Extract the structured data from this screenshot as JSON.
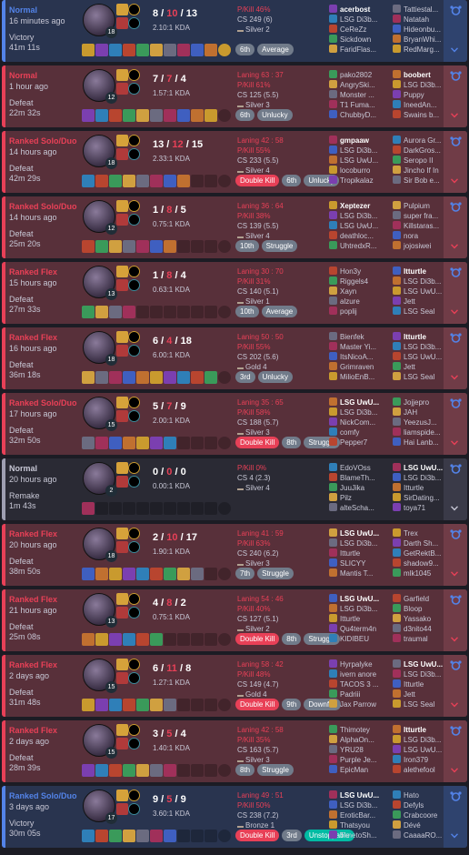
{
  "icons": {
    "expand": "chevron-down-icon",
    "tag": "share-icon"
  },
  "colors": {
    "win": "#5383e8",
    "loss": "#e84057",
    "remake": "#9e9eb1",
    "badge": "#717b8a",
    "badge_multikill": "#e84057",
    "badge_top": "#00bba3"
  },
  "matches": [
    {
      "result": "win",
      "queue": "Normal",
      "ago": "16 minutes ago",
      "outcome": "Victory",
      "duration": "41m 11s",
      "level": "18",
      "kda": {
        "k": "8",
        "d": "10",
        "a": "13"
      },
      "kda_ratio": "2.10:1 KDA",
      "laning": "",
      "pk": "P/Kill 46%",
      "cs": "CS 249 (6)",
      "rank": "Silver 2",
      "items": 11,
      "badges": [
        "6th",
        "Average"
      ],
      "team1": [
        "acerbost",
        "LSG Di3b...",
        "CeReZz",
        "Sickdown",
        "FaridFlas..."
      ],
      "team2": [
        "Tattiestal...",
        "Natatah",
        "Hideonbu...",
        "BryanWhi...",
        "RedMarg..."
      ],
      "me": 1
    },
    {
      "result": "loss",
      "queue": "Normal",
      "ago": "1 hour ago",
      "outcome": "Defeat",
      "duration": "22m 32s",
      "level": "12",
      "kda": {
        "k": "7",
        "d": "7",
        "a": "4"
      },
      "kda_ratio": "1.57:1 KDA",
      "laning": "Laning 63 : 37",
      "pk": "P/Kill 61%",
      "cs": "CS 125 (5.5)",
      "rank": "Silver 3",
      "items": 10,
      "badges": [
        "6th",
        "Unlucky"
      ],
      "team1": [
        "pako2802",
        "AngrySki...",
        "Monster ...",
        "T1 Fuma...",
        "ChubbyD..."
      ],
      "team2": [
        "boobert",
        "LSG Di3b...",
        "Puppy",
        "IneedAn...",
        "Swains b..."
      ],
      "me": 6
    },
    {
      "result": "loss",
      "queue": "Ranked Solo/Duo",
      "ago": "14 hours ago",
      "outcome": "Defeat",
      "duration": "42m 29s",
      "level": "18",
      "kda": {
        "k": "13",
        "d": "12",
        "a": "15"
      },
      "kda_ratio": "2.33:1 KDA",
      "laning": "Laning 42 : 58",
      "pk": "P/Kill 55%",
      "cs": "CS 233 (5.5)",
      "rank": "Silver 4",
      "items": 8,
      "badges": [
        "Double Kill",
        "6th",
        "Unlucky"
      ],
      "team1": [
        "gmpaaw",
        "LSG Di3b...",
        "LSG UwU...",
        "locoburro",
        "Tropikalaz"
      ],
      "team2": [
        "Aurora Gr...",
        "DarkGros...",
        "Seropo II",
        "Jincho If In",
        "Sir Bob e..."
      ],
      "me": 1
    },
    {
      "result": "loss",
      "queue": "Ranked Solo/Duo",
      "ago": "14 hours ago",
      "outcome": "Defeat",
      "duration": "25m 20s",
      "level": "12",
      "kda": {
        "k": "1",
        "d": "8",
        "a": "5"
      },
      "kda_ratio": "0.75:1 KDA",
      "laning": "Laning 36 : 64",
      "pk": "P/Kill 38%",
      "cs": "CS 139 (5.5)",
      "rank": "Silver 4",
      "items": 7,
      "badges": [
        "10th",
        "Struggle"
      ],
      "team1": [
        "Xeptezer",
        "LSG Di3b...",
        "LSG UwU...",
        "deathloc...",
        "UhtredxR..."
      ],
      "team2": [
        "Pulpium",
        "super fra...",
        "Killstaras...",
        "nora",
        "jojosiwei"
      ],
      "me": 1
    },
    {
      "result": "loss",
      "queue": "Ranked Flex",
      "ago": "15 hours ago",
      "outcome": "Defeat",
      "duration": "27m 33s",
      "level": "13",
      "kda": {
        "k": "1",
        "d": "8",
        "a": "4"
      },
      "kda_ratio": "0.63:1 KDA",
      "laning": "Laning 30 : 70",
      "pk": "P/Kill 31%",
      "cs": "CS 140 (5.1)",
      "rank": "Silver 1",
      "items": 4,
      "badges": [
        "10th",
        "Average"
      ],
      "team1": [
        "Hon3y",
        "Riggels4",
        "Xayn",
        "alzure",
        "poplij"
      ],
      "team2": [
        "Itturtle",
        "LSG Di3b...",
        "LSG UwU...",
        "Jett",
        "LSG Seal"
      ],
      "me": 6
    },
    {
      "result": "loss",
      "queue": "Ranked Flex",
      "ago": "16 hours ago",
      "outcome": "Defeat",
      "duration": "36m 18s",
      "level": "18",
      "kda": {
        "k": "6",
        "d": "4",
        "a": "18"
      },
      "kda_ratio": "6.00:1 KDA",
      "laning": "Laning 50 : 50",
      "pk": "P/Kill 55%",
      "cs": "CS 202 (5.6)",
      "rank": "Gold 4",
      "items": 10,
      "badges": [
        "3rd",
        "Unlucky"
      ],
      "team1": [
        "Bienfek",
        "Master Yi...",
        "ItsNicoA...",
        "Grimraven",
        "MilioEnB..."
      ],
      "team2": [
        "Itturtle",
        "LSG Di3b...",
        "LSG UwU...",
        "Jett",
        "LSG Seal"
      ],
      "me": 6
    },
    {
      "result": "loss",
      "queue": "Ranked Solo/Duo",
      "ago": "17 hours ago",
      "outcome": "Defeat",
      "duration": "32m 50s",
      "level": "15",
      "kda": {
        "k": "5",
        "d": "7",
        "a": "9"
      },
      "kda_ratio": "2.00:1 KDA",
      "laning": "Laning 35 : 65",
      "pk": "P/Kill 58%",
      "cs": "CS 188 (5.7)",
      "rank": "Silver 3",
      "items": 7,
      "badges": [
        "Double Kill",
        "8th",
        "Struggle"
      ],
      "team1": [
        "LSG UwU...",
        "LSG Di3b...",
        "NickCom...",
        "comfy",
        "Pepper7"
      ],
      "team2": [
        "Jojjepro",
        "JAH",
        "YeezusJ...",
        "liamspide...",
        "Hai Lanb..."
      ],
      "me": 1
    },
    {
      "result": "remake",
      "queue": "Normal",
      "ago": "20 hours ago",
      "outcome": "Remake",
      "duration": "1m 43s",
      "level": "2",
      "kda": {
        "k": "0",
        "d": "0",
        "a": "0"
      },
      "kda_ratio": "0.00:1 KDA",
      "laning": "",
      "pk": "P/Kill 0%",
      "cs": "CS 4 (2.3)",
      "rank": "Silver 4",
      "items": 1,
      "badges": [],
      "team1": [
        "EdoVOss",
        "BlameTh...",
        "JuuJika",
        "Pilz",
        "alteScha..."
      ],
      "team2": [
        "LSG UwU...",
        "LSG Di3b...",
        "Itturtle",
        "SirDating...",
        "toya71"
      ],
      "me": 6
    },
    {
      "result": "loss",
      "queue": "Ranked Flex",
      "ago": "20 hours ago",
      "outcome": "Defeat",
      "duration": "38m 50s",
      "level": "18",
      "kda": {
        "k": "2",
        "d": "10",
        "a": "17"
      },
      "kda_ratio": "1.90:1 KDA",
      "laning": "Laning 41 : 59",
      "pk": "P/Kill 63%",
      "cs": "CS 240 (6.2)",
      "rank": "Silver 3",
      "items": 9,
      "badges": [
        "7th",
        "Struggle"
      ],
      "team1": [
        "LSG UwU...",
        "LSG Di3b...",
        "Itturtle",
        "SLICYY",
        "Mantis T..."
      ],
      "team2": [
        "Trex",
        "Darth Sh...",
        "GetRektB...",
        "shadow9...",
        "mlk1045"
      ],
      "me": 1
    },
    {
      "result": "loss",
      "queue": "Ranked Flex",
      "ago": "21 hours ago",
      "outcome": "Defeat",
      "duration": "25m 08s",
      "level": "13",
      "kda": {
        "k": "4",
        "d": "8",
        "a": "2"
      },
      "kda_ratio": "0.75:1 KDA",
      "laning": "Laning 54 : 46",
      "pk": "P/Kill 40%",
      "cs": "CS 127 (5.1)",
      "rank": "Silver 2",
      "items": 6,
      "badges": [
        "Double Kill",
        "8th",
        "Struggle"
      ],
      "team1": [
        "LSG UwU...",
        "LSG Di3b...",
        "Itturtle",
        "Qu4term4n",
        "KIDIBEU"
      ],
      "team2": [
        "Garfield",
        "Bloop",
        "Yassako",
        "d3nito44",
        "traumal"
      ],
      "me": 1
    },
    {
      "result": "loss",
      "queue": "Ranked Flex",
      "ago": "2 days ago",
      "outcome": "Defeat",
      "duration": "31m 48s",
      "level": "15",
      "kda": {
        "k": "6",
        "d": "11",
        "a": "8"
      },
      "kda_ratio": "1.27:1 KDA",
      "laning": "Laning 58 : 42",
      "pk": "P/Kill 48%",
      "cs": "CS 149 (4.7)",
      "rank": "Gold 4",
      "items": 7,
      "badges": [
        "Double Kill",
        "9th",
        "Downfall"
      ],
      "team1": [
        "Hyrpalyke",
        "ivern anore",
        "TACOS 3 ...",
        "Padriii",
        "Jax Parrow"
      ],
      "team2": [
        "LSG UwU...",
        "LSG Di3b...",
        "Itturtle",
        "Jett",
        "LSG Seal"
      ],
      "me": 6
    },
    {
      "result": "loss",
      "queue": "Ranked Flex",
      "ago": "2 days ago",
      "outcome": "Defeat",
      "duration": "28m 39s",
      "level": "15",
      "kda": {
        "k": "3",
        "d": "5",
        "a": "4"
      },
      "kda_ratio": "1.40:1 KDA",
      "laning": "Laning 42 : 58",
      "pk": "P/Kill 35%",
      "cs": "CS 163 (5.7)",
      "rank": "Silver 3",
      "items": 7,
      "badges": [
        "8th",
        "Struggle"
      ],
      "team1": [
        "Thimotey",
        "AlphaOn...",
        "YRU28",
        "Purple Je...",
        "EpicMan"
      ],
      "team2": [
        "Itturtle",
        "LSG Di3b...",
        "LSG UwU...",
        "Iron379",
        "alethefool"
      ],
      "me": 6
    },
    {
      "result": "win",
      "queue": "Ranked Solo/Duo",
      "ago": "3 days ago",
      "outcome": "Victory",
      "duration": "30m 05s",
      "level": "17",
      "kda": {
        "k": "9",
        "d": "5",
        "a": "9"
      },
      "kda_ratio": "3.60:1 KDA",
      "laning": "Laning 49 : 51",
      "pk": "P/Kill 50%",
      "cs": "CS 238 (7.2)",
      "rank": "Bronze 1",
      "items": 7,
      "badges": [
        "Double Kill",
        "3rd",
        "Unstoppable"
      ],
      "team1": [
        "LSG UwU...",
        "LSG Di3b...",
        "EroticBar...",
        "Thatsyou",
        "TimetoSh..."
      ],
      "team2": [
        "Hato",
        "Defyls",
        "Crabcoore",
        "Dévé",
        "CaaaaRO..."
      ],
      "me": 1
    }
  ]
}
